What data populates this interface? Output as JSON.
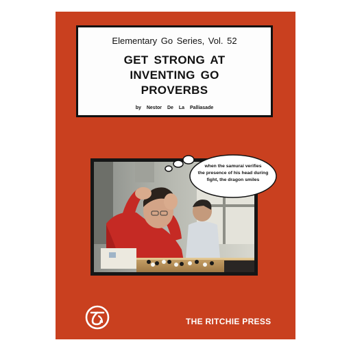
{
  "cover": {
    "series": "Elementary Go Series, Vol. 52",
    "title_line1": "GET STRONG AT",
    "title_line2": "INVENTING GO",
    "title_line3": "PROVERBS",
    "author": "by Nestor De La Palliasade",
    "speech_line1": "when the samurai verifies",
    "speech_line2": "the presence of his head during",
    "speech_line3": "fight, the dragon smiles",
    "publisher": "THE RITCHIE PRESS",
    "logo_icon": "ritchie-press-logo-icon",
    "colors": {
      "cover": "#c9401f",
      "panel": "#fdfdfd",
      "frame": "#111111"
    }
  }
}
